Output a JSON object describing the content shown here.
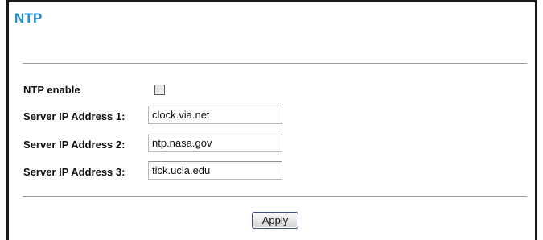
{
  "page": {
    "title": "NTP"
  },
  "form": {
    "ntp_enable": {
      "label": "NTP enable",
      "checked": false
    },
    "servers": [
      {
        "label": "Server IP Address 1:",
        "value": "clock.via.net"
      },
      {
        "label": "Server IP Address 2:",
        "value": "ntp.nasa.gov"
      },
      {
        "label": "Server IP Address 3:",
        "value": "tick.ucla.edu"
      }
    ]
  },
  "actions": {
    "apply_label": "Apply"
  },
  "colors": {
    "title": "#1b8dd0",
    "divider": "#9a9a9a",
    "frame": "#1a1a1a"
  }
}
